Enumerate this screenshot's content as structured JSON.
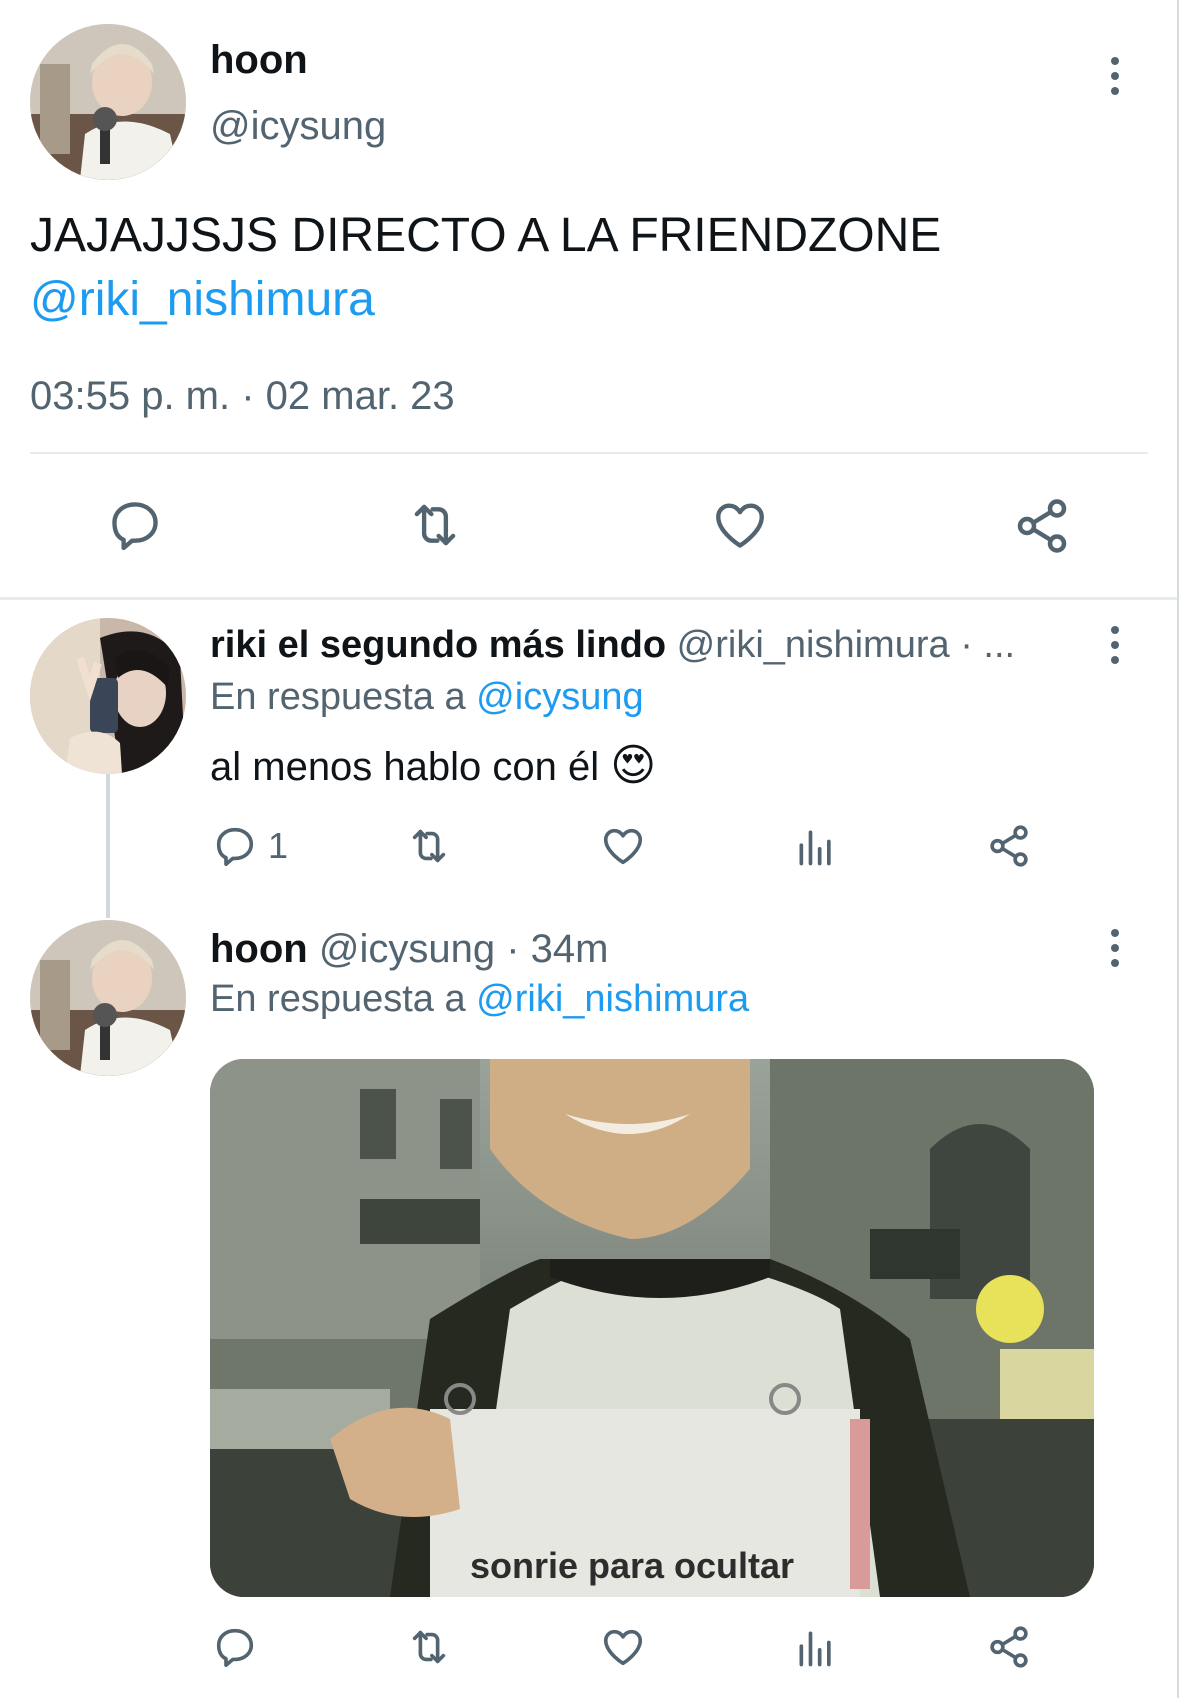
{
  "main_tweet": {
    "display_name": "hoon",
    "handle": "@icysung",
    "text": "JAJAJJSJS DIRECTO A LA FRIENDZONE",
    "mention": "@riki_nishimura",
    "timestamp": "03:55 p. m. · 02 mar. 23"
  },
  "reply_1": {
    "display_name": "riki el segundo más lindo",
    "handle": "@riki_nishimura",
    "meta_suffix": " · ...",
    "reply_prefix": "En respuesta a",
    "reply_to": "@icysung",
    "text": "al menos hablo con él",
    "emoji": "😍",
    "reply_count": "1"
  },
  "reply_2": {
    "display_name": "hoon",
    "handle": "@icysung",
    "time": "· 34m",
    "reply_prefix": "En respuesta a",
    "reply_to": "@riki_nishimura",
    "image_caption": "sonrie para ocultar"
  },
  "icons": {
    "reply": "reply-icon",
    "retweet": "retweet-icon",
    "like": "heart-icon",
    "share": "share-icon",
    "views": "views-icon",
    "more": "more-icon"
  },
  "colors": {
    "link": "#1d9bf0",
    "muted": "#536471",
    "text": "#0f1419",
    "divider": "#e6ebee"
  }
}
